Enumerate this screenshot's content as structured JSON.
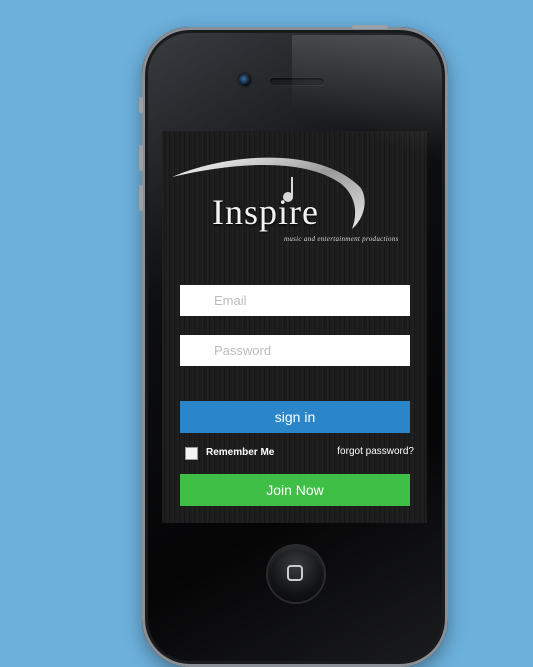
{
  "app": {
    "logo_text": "Inspire",
    "logo_tagline": "music and entertainment productions"
  },
  "login": {
    "email_placeholder": "Email",
    "password_placeholder": "Password",
    "signin_label": "sign in",
    "remember_label": "Remember Me",
    "remember_checked": false,
    "forgot_label": "forgot password?",
    "join_label": "Join Now"
  },
  "colors": {
    "background": "#6cb0dc",
    "signin_button": "#2a86c9",
    "join_button": "#3fbf45"
  },
  "icons": [
    "camera-icon",
    "home-button-icon"
  ]
}
